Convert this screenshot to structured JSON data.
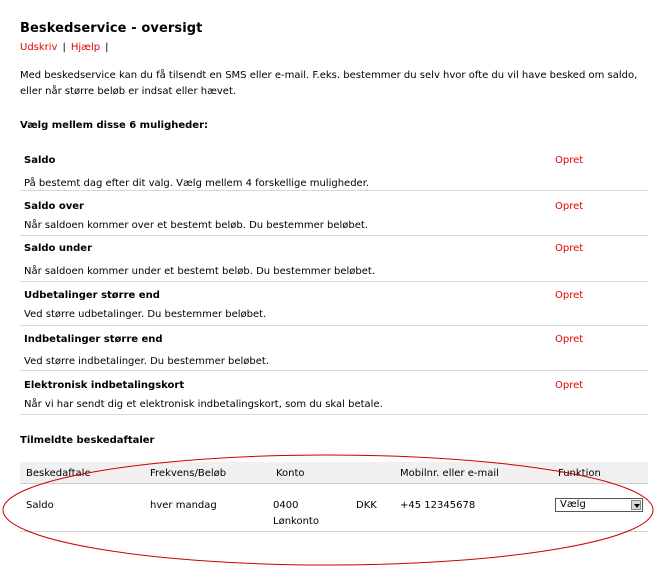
{
  "page": {
    "title": "Beskedservice - oversigt",
    "links": {
      "print": "Udskriv",
      "help": "Hjælp",
      "separator": "|"
    },
    "intro": "Med beskedservice kan du få tilsendt en SMS eller e-mail. F.eks. bestemmer du selv hvor ofte du vil have besked om saldo, eller når større beløb er indsat eller hævet.",
    "options_heading": "Vælg mellem disse 6 muligheder:",
    "subscriptions_heading": "Tilmeldte beskedaftaler"
  },
  "options": [
    {
      "title": "Saldo",
      "desc": "På bestemt dag efter dit valg. Vælg mellem 4 forskellige muligheder.",
      "action": "Opret"
    },
    {
      "title": "Saldo over",
      "desc": "Når saldoen kommer over et bestemt beløb. Du bestemmer beløbet.",
      "action": "Opret"
    },
    {
      "title": "Saldo under",
      "desc": "Når saldoen kommer under et bestemt beløb. Du bestemmer beløbet.",
      "action": "Opret"
    },
    {
      "title": "Udbetalinger større end",
      "desc": "Ved større udbetalinger. Du bestemmer beløbet.",
      "action": "Opret"
    },
    {
      "title": "Indbetalinger større end",
      "desc": "Ved større indbetalinger. Du bestemmer beløbet.",
      "action": "Opret"
    },
    {
      "title": "Elektronisk indbetalingskort",
      "desc": "Når vi har sendt dig et elektronisk indbetalingskort, som du skal betale.",
      "action": "Opret"
    }
  ],
  "table": {
    "headers": {
      "agreement": "Beskedaftale",
      "frequency": "Frekvens/Beløb",
      "account": "Konto",
      "contact": "Mobilnr. eller e-mail",
      "function": "Funktion"
    },
    "rows": [
      {
        "agreement": "Saldo",
        "frequency": "hver mandag",
        "account_number": "0400",
        "account_name": "Lønkonto",
        "currency": "DKK",
        "contact": "+45 12345678",
        "function_selected": "Vælg"
      }
    ]
  },
  "annotation": {
    "ellipse_color": "#cc0000"
  }
}
